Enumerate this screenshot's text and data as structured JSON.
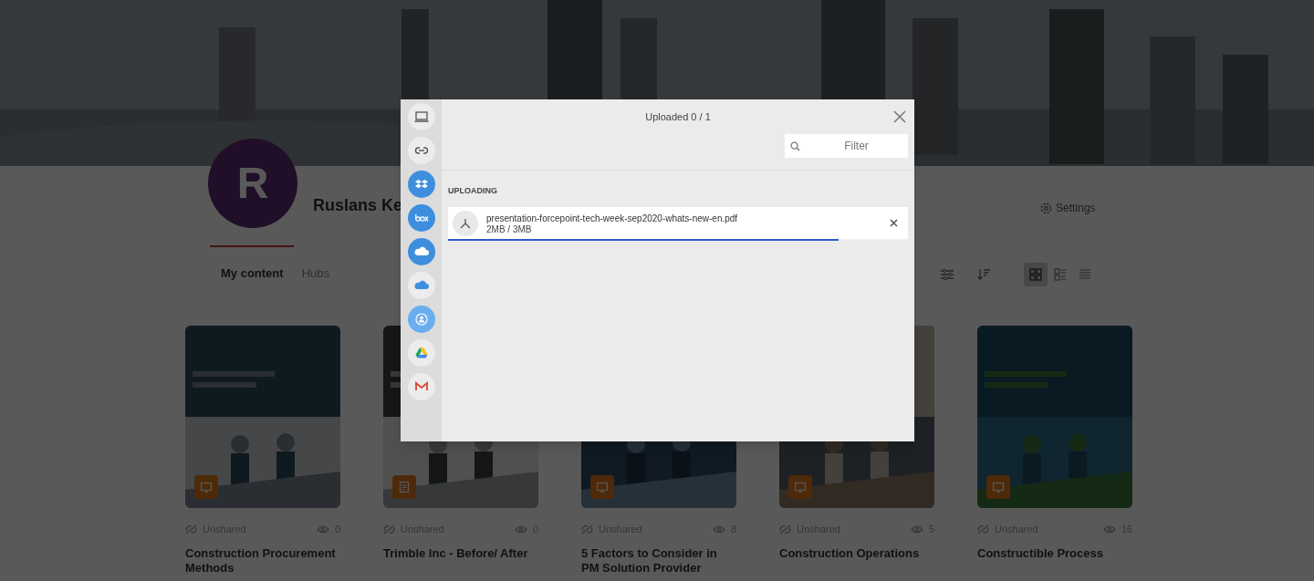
{
  "profile": {
    "initial": "R",
    "name": "Ruslans Ke"
  },
  "settings_label": "Settings",
  "tabs": [
    {
      "label": "My content",
      "selected": true
    },
    {
      "label": "Hubs",
      "selected": false
    }
  ],
  "view_modes": [
    {
      "kind": "grid",
      "selected": true
    },
    {
      "kind": "split",
      "selected": false
    },
    {
      "kind": "list",
      "selected": false
    }
  ],
  "cards": [
    {
      "title": "Construction Procurement Methods",
      "status": "Unshared",
      "views": "0",
      "kind": "presentation"
    },
    {
      "title": "Trimble Inc - Before/ After",
      "status": "Unshared",
      "views": "0",
      "kind": "document"
    },
    {
      "title": "5 Factors to Consider in PM Solution Provider",
      "status": "Unshared",
      "views": "8",
      "kind": "presentation"
    },
    {
      "title": "Construction Operations",
      "status": "Unshared",
      "views": "5",
      "kind": "presentation"
    },
    {
      "title": "Constructible Process",
      "status": "Unshared",
      "views": "16",
      "kind": "presentation"
    }
  ],
  "upload_dialog": {
    "title": "Uploaded 0 / 1",
    "filter_placeholder": "Filter",
    "section": "UPLOADING",
    "sources": [
      {
        "kind": "computer"
      },
      {
        "kind": "link"
      },
      {
        "kind": "dropbox"
      },
      {
        "kind": "box"
      },
      {
        "kind": "onedrive"
      },
      {
        "kind": "onedrive-business"
      },
      {
        "kind": "contact"
      },
      {
        "kind": "drive"
      },
      {
        "kind": "gmail"
      }
    ],
    "files": [
      {
        "name": "presentation-forcepoint-tech-week-sep2020-whats-new-en.pdf",
        "progress": "2MB / 3MB",
        "level": 0.85
      }
    ]
  }
}
